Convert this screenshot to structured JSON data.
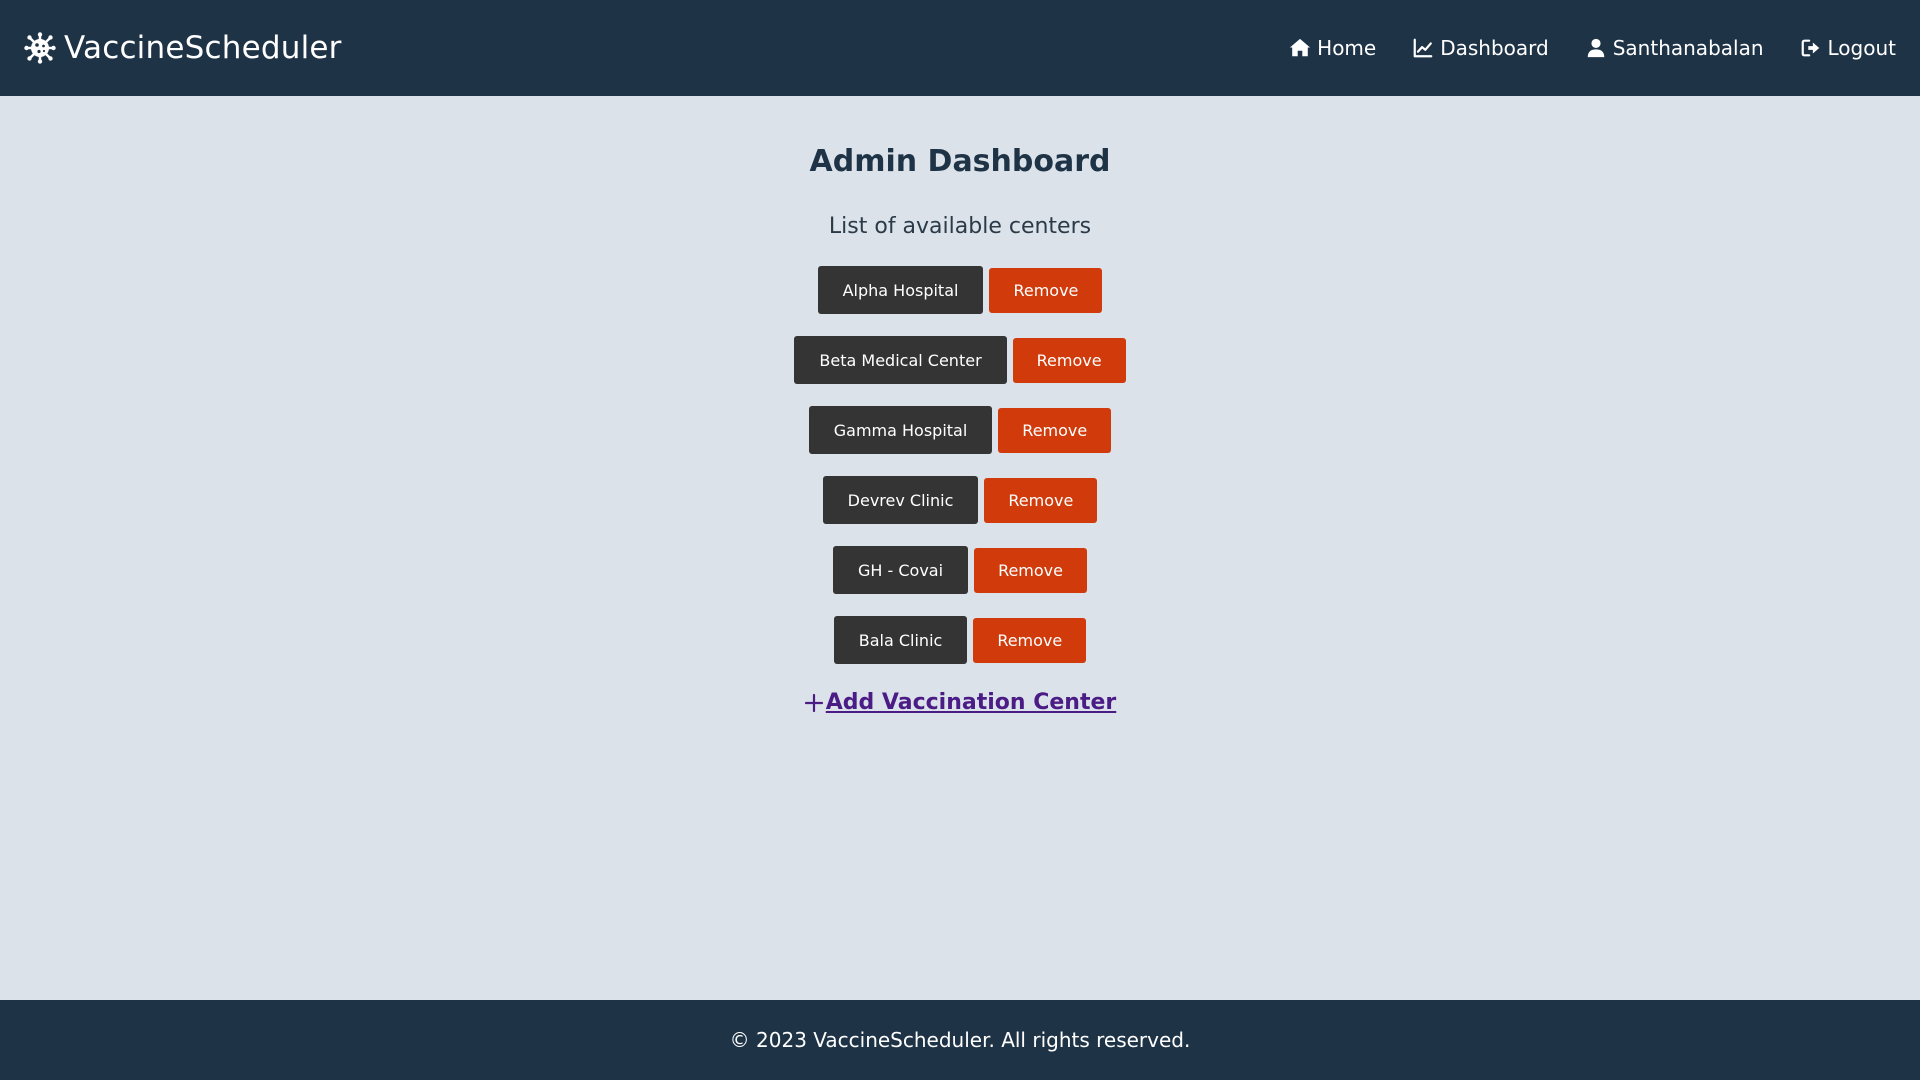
{
  "navbar": {
    "brand": "VaccineScheduler",
    "brand_icon": "virus-icon",
    "links": [
      {
        "label": "Home",
        "icon": "home-icon"
      },
      {
        "label": "Dashboard",
        "icon": "chart-line-icon"
      },
      {
        "label": "Santhanabalan",
        "icon": "user-icon"
      },
      {
        "label": "Logout",
        "icon": "logout-icon"
      }
    ]
  },
  "main": {
    "title": "Admin Dashboard",
    "subtitle": "List of available centers",
    "centers": [
      {
        "name": "Alpha Hospital",
        "remove_label": "Remove"
      },
      {
        "name": "Beta Medical Center",
        "remove_label": "Remove"
      },
      {
        "name": "Gamma Hospital",
        "remove_label": "Remove"
      },
      {
        "name": "Devrev Clinic",
        "remove_label": "Remove"
      },
      {
        "name": "GH - Covai",
        "remove_label": "Remove"
      },
      {
        "name": "Bala Clinic",
        "remove_label": "Remove"
      }
    ],
    "add_link": "Add Vaccination Center",
    "add_icon": "plus-icon"
  },
  "footer": {
    "text": "© 2023 VaccineScheduler. All rights reserved."
  },
  "colors": {
    "navbar_bg": "#1f3347",
    "page_bg": "#dbe2e9",
    "center_button": "#343434",
    "remove_button": "#d13b0c",
    "link": "#4b1c86"
  }
}
